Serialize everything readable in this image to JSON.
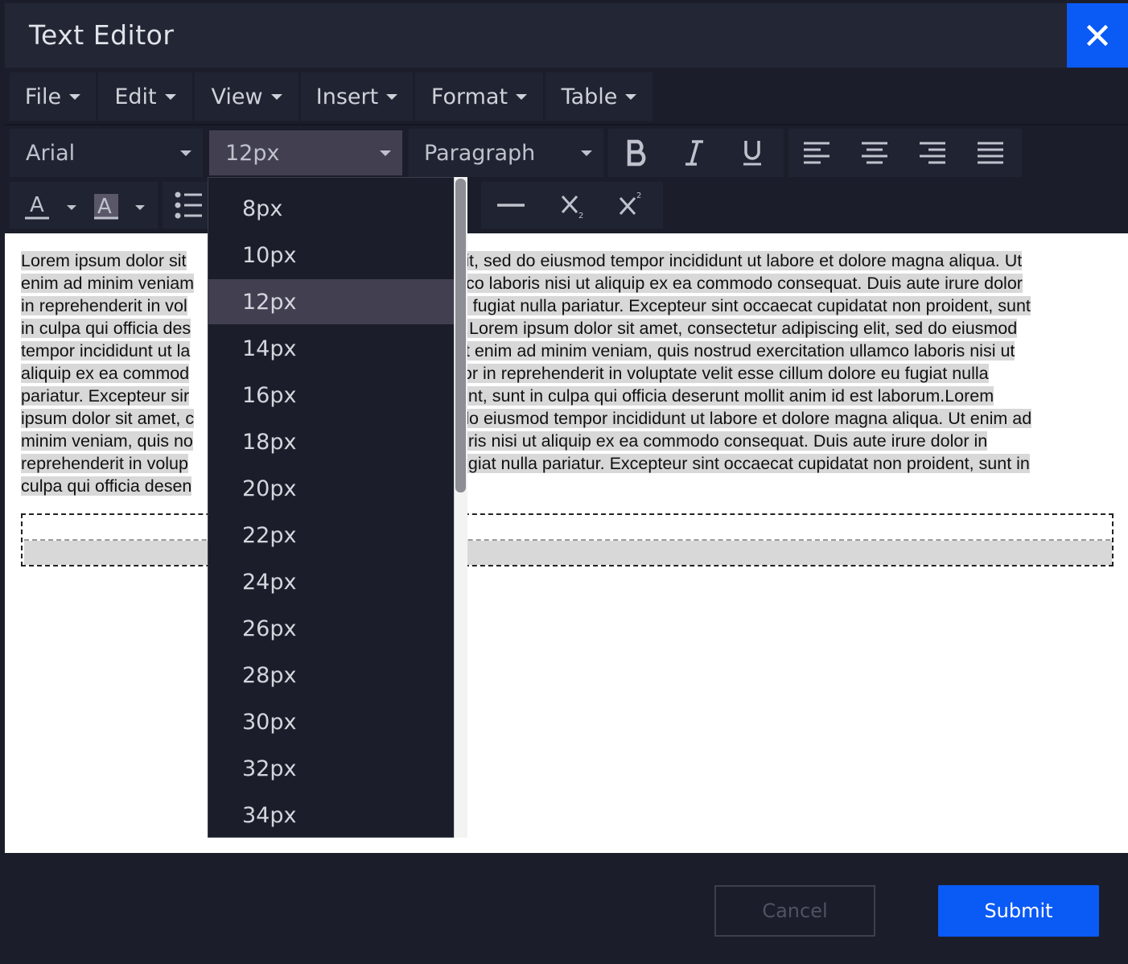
{
  "window": {
    "title": "Text Editor",
    "close_icon": "close-icon",
    "accent_color": "#0a5af5"
  },
  "menubar": {
    "items": [
      {
        "label": "File"
      },
      {
        "label": "Edit"
      },
      {
        "label": "View"
      },
      {
        "label": "Insert"
      },
      {
        "label": "Format"
      },
      {
        "label": "Table"
      }
    ]
  },
  "toolbar": {
    "font_family": "Arial",
    "font_size": "12px",
    "block_format": "Paragraph",
    "icons_row1": [
      "bold-icon",
      "italic-icon",
      "underline-icon",
      "align-left-icon",
      "align-center-icon",
      "align-right-icon",
      "align-justify-icon"
    ],
    "icons_row2": [
      "text-color-icon",
      "background-color-icon",
      "bullet-list-icon",
      "horizontal-rule-icon",
      "subscript-icon",
      "superscript-icon"
    ]
  },
  "font_size_dropdown": {
    "options": [
      "8px",
      "10px",
      "12px",
      "14px",
      "16px",
      "18px",
      "20px",
      "22px",
      "24px",
      "26px",
      "28px",
      "30px",
      "32px",
      "34px"
    ],
    "selected": "12px"
  },
  "editor": {
    "lines": [
      [
        "Lorem ipsum dolor sit",
        "elit, sed do eiusmod tempor incididunt ut labore et dolore magna aliqua. Ut"
      ],
      [
        "enim ad minim veniam",
        "mco laboris nisi ut aliquip ex ea commodo consequat. Duis aute irure dolor"
      ],
      [
        "in reprehenderit in vol",
        "eu fugiat nulla pariatur. Excepteur sint occaecat cupidatat non proident, sunt"
      ],
      [
        "in culpa qui officia des",
        "m.Lorem ipsum dolor sit amet, consectetur adipiscing elit, sed do eiusmod"
      ],
      [
        "tempor incididunt ut la",
        "Ut enim ad minim veniam, quis nostrud exercitation ullamco laboris nisi ut"
      ],
      [
        "aliquip ex ea commod",
        "olor in reprehenderit in voluptate velit esse cillum dolore eu fugiat nulla"
      ],
      [
        "pariatur. Excepteur sir",
        "lent, sunt in culpa qui officia deserunt mollit anim id est laborum.Lorem"
      ],
      [
        "ipsum dolor sit amet, c",
        "do eiusmod tempor incididunt ut labore et dolore magna aliqua. Ut enim ad"
      ],
      [
        "minim veniam, quis no",
        "oris nisi ut aliquip ex ea commodo consequat. Duis aute irure dolor in"
      ],
      [
        "reprehenderit in volup",
        "fugiat nulla pariatur. Excepteur sint occaecat cupidatat non proident, sunt in"
      ],
      [
        "culpa qui officia desen",
        ""
      ]
    ]
  },
  "footer": {
    "cancel_label": "Cancel",
    "submit_label": "Submit"
  }
}
